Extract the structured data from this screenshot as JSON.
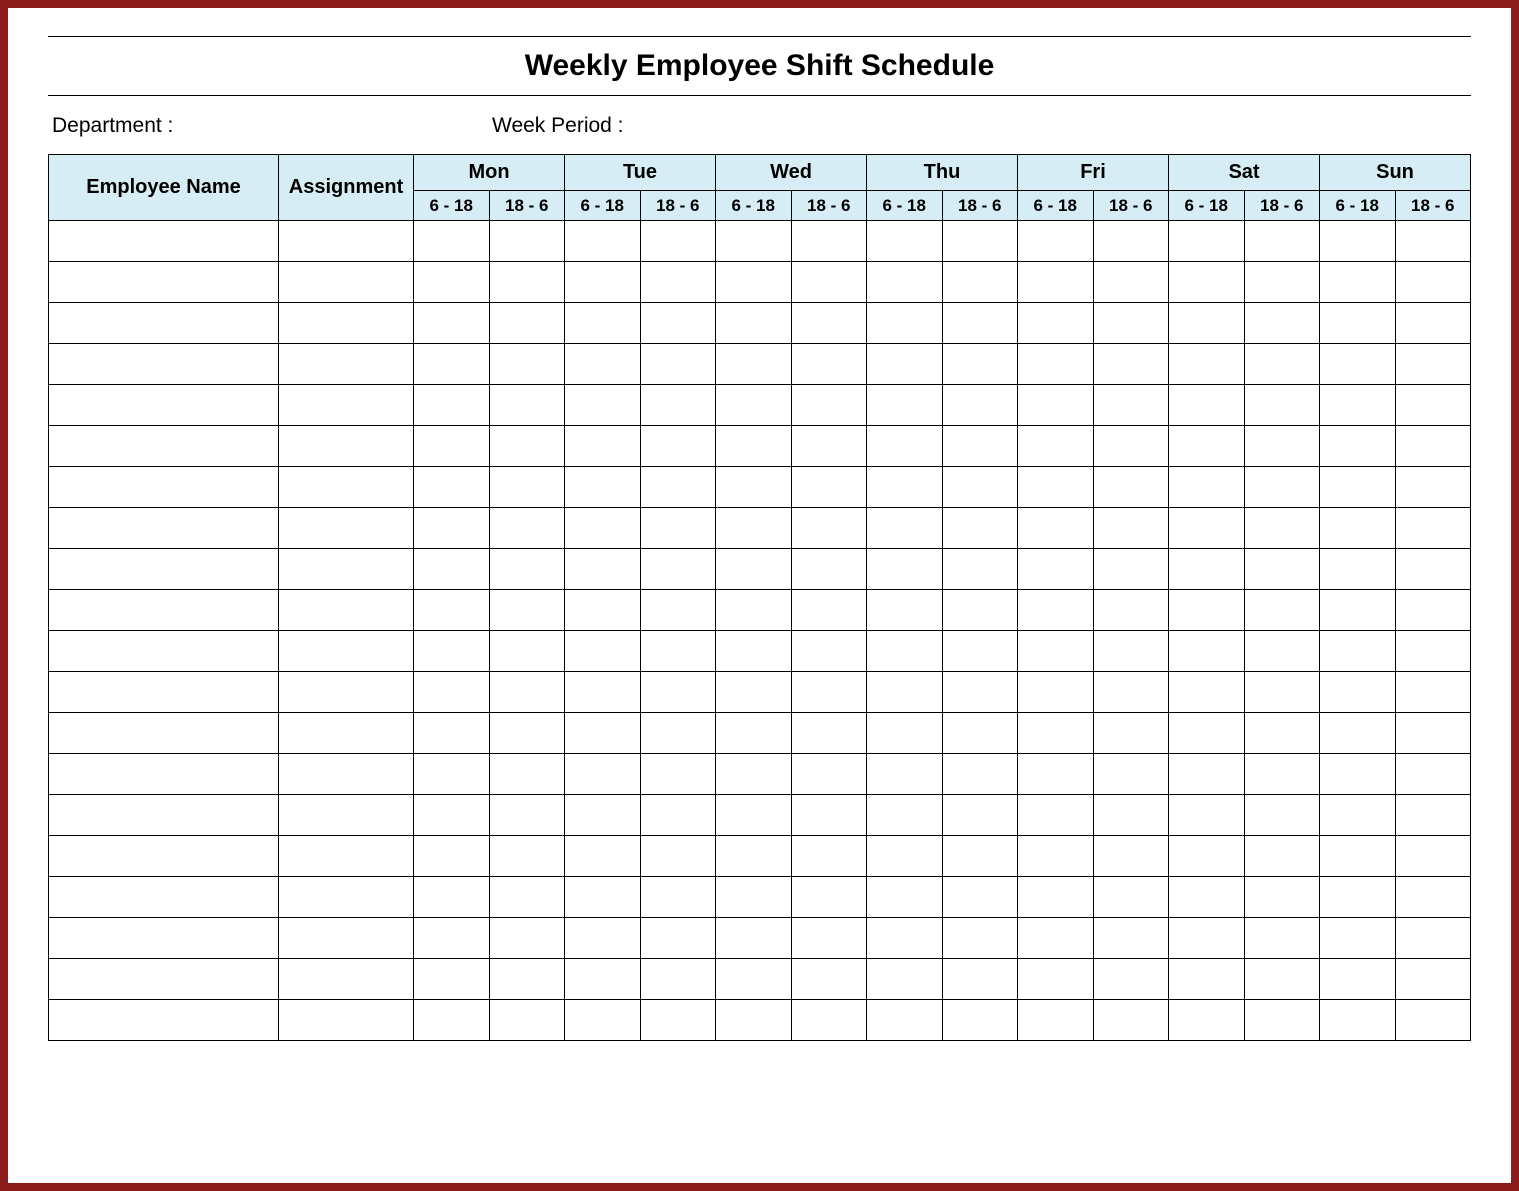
{
  "title": "Weekly Employee Shift Schedule",
  "labels": {
    "department": "Department :",
    "week_period": "Week  Period :",
    "employee_name": "Employee Name",
    "assignment": "Assignment"
  },
  "days": [
    "Mon",
    "Tue",
    "Wed",
    "Thu",
    "Fri",
    "Sat",
    "Sun"
  ],
  "shifts": [
    "6 - 18",
    "18 - 6"
  ],
  "row_count": 20,
  "colors": {
    "header_bg": "#d6edf5",
    "frame_border": "#8b1a1a"
  }
}
